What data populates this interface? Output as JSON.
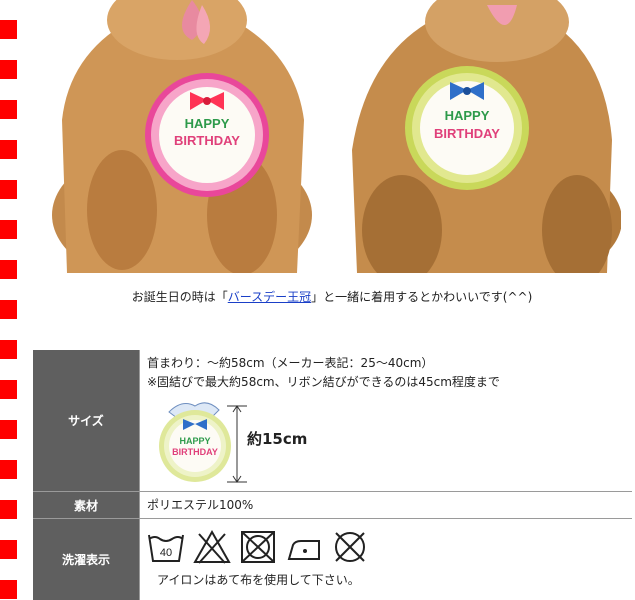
{
  "caption": {
    "prefix": "お誕生日の時は「",
    "link_text": "バースデー王冠",
    "suffix": "」と一緒に着用するとかわいいです(^^)"
  },
  "photos": {
    "left": {
      "bib_text_top": "HAPPY",
      "bib_text_bottom": "BIRTHDAY"
    },
    "right": {
      "bib_text_top": "HAPPY",
      "bib_text_bottom": "BIRTHDAY"
    }
  },
  "spec": {
    "size": {
      "label": "サイズ",
      "line1": "首まわり：～約58cm（メーカー表記：25～40cm）",
      "line2": "※固結びで最大約58cm、リボン結びができるのは45cm程度まで",
      "dimension": "約15cm",
      "bib_text_top": "HAPPY",
      "bib_text_bottom": "BIRTHDAY"
    },
    "material": {
      "label": "素材",
      "value": "ポリエステル100%"
    },
    "wash": {
      "label": "洗濯表示",
      "temp": "40",
      "note": "アイロンはあて布を使用して下さい。"
    }
  },
  "colors": {
    "dash": "#ff0000",
    "label_bg": "#5f5f5f",
    "link": "#1a3fc7"
  }
}
